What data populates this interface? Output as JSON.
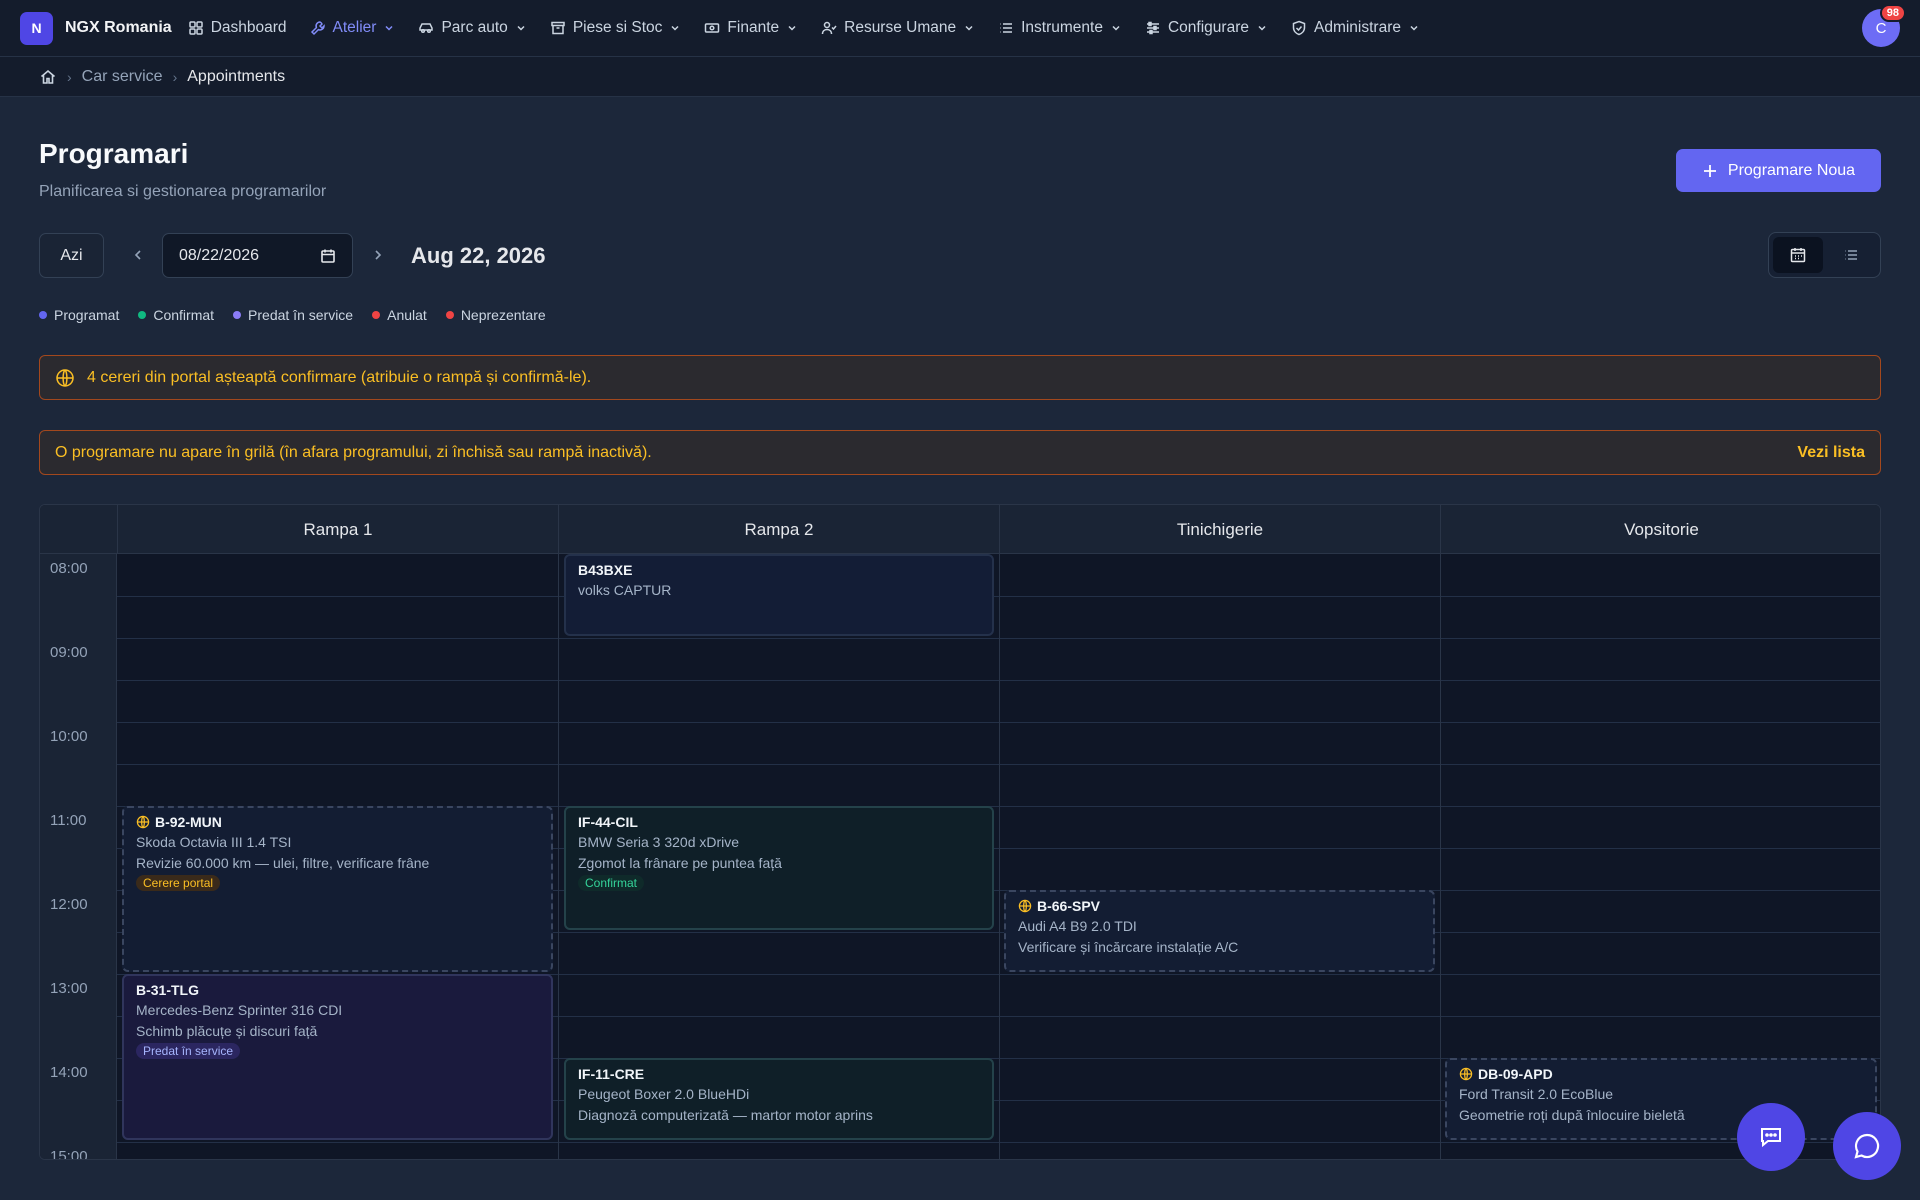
{
  "brand": {
    "initial": "N",
    "name": "NGX Romania"
  },
  "nav": [
    {
      "label": "Dashboard",
      "icon": "grid-icon"
    },
    {
      "label": "Atelier",
      "icon": "wrench-icon",
      "active": true
    },
    {
      "label": "Parc auto",
      "icon": "car-icon"
    },
    {
      "label": "Piese si Stoc",
      "icon": "archive-icon"
    },
    {
      "label": "Finante",
      "icon": "banknote-icon"
    },
    {
      "label": "Resurse Umane",
      "icon": "users-icon"
    },
    {
      "label": "Instrumente",
      "icon": "list-icon"
    },
    {
      "label": "Configurare",
      "icon": "sliders-icon"
    },
    {
      "label": "Administrare",
      "icon": "shield-icon"
    }
  ],
  "user": {
    "initial": "C",
    "notifications": "98"
  },
  "breadcrumb": {
    "level1": "Car service",
    "level2": "Appointments"
  },
  "header": {
    "title": "Programari",
    "subtitle": "Planificarea si gestionarea programarilor",
    "new_button": "Programare Noua"
  },
  "toolbar": {
    "today": "Azi",
    "date_value": "08/22/2026",
    "date_label": "Aug 22, 2026"
  },
  "legend": [
    {
      "label": "Programat",
      "color": "#6366f1"
    },
    {
      "label": "Confirmat",
      "color": "#10b981"
    },
    {
      "label": "Predat în service",
      "color": "#8b7cf6"
    },
    {
      "label": "Anulat",
      "color": "#ef4444"
    },
    {
      "label": "Neprezentare",
      "color": "#ef4444"
    }
  ],
  "alerts": {
    "portal": "4 cereri din portal așteaptă confirmare (atribuie o rampă și confirmă-le).",
    "hidden": "O programare nu apare în grilă (în afara programului, zi închisă sau rampă inactivă).",
    "hidden_link": "Vezi lista"
  },
  "columns": [
    "Rampa 1",
    "Rampa 2",
    "Tinichigerie",
    "Vopsitorie"
  ],
  "times": [
    "08:00",
    "09:00",
    "10:00",
    "11:00",
    "12:00",
    "13:00",
    "14:00",
    "15:00"
  ],
  "appointments": [
    {
      "plate": "B43BXE",
      "car": "volks CAPTUR",
      "desc": "",
      "tag": ""
    },
    {
      "plate": "B-92-MUN",
      "car": "Skoda Octavia III 1.4 TSI",
      "desc": "Revizie 60.000 km — ulei, filtre, verificare frâne",
      "tag": "Cerere portal"
    },
    {
      "plate": "IF-44-CIL",
      "car": "BMW Seria 3 320d xDrive",
      "desc": "Zgomot la frânare pe puntea față",
      "tag": "Confirmat"
    },
    {
      "plate": "B-66-SPV",
      "car": "Audi A4 B9 2.0 TDI",
      "desc": "Verificare și încărcare instalație A/C",
      "tag": ""
    },
    {
      "plate": "B-31-TLG",
      "car": "Mercedes-Benz Sprinter 316 CDI",
      "desc": "Schimb plăcuțe și discuri față",
      "tag": "Predat în service"
    },
    {
      "plate": "IF-11-CRE",
      "car": "Peugeot Boxer 2.0 BlueHDi",
      "desc": "Diagnoză computerizată — martor motor aprins",
      "tag": ""
    },
    {
      "plate": "DB-09-APD",
      "car": "Ford Transit 2.0 EcoBlue",
      "desc": "Geometrie roți după înlocuire bieletă",
      "tag": ""
    }
  ]
}
